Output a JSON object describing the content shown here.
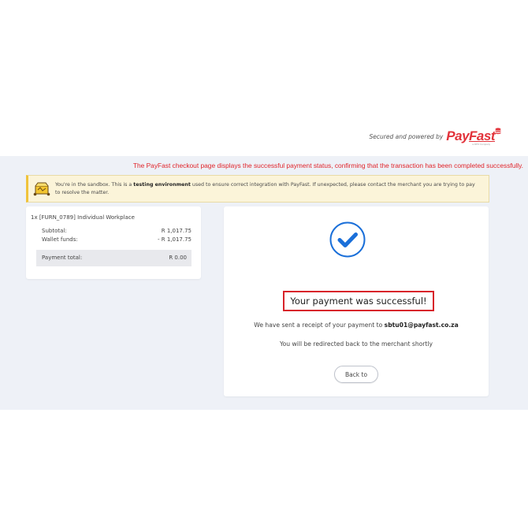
{
  "header": {
    "powered_text": "Secured and powered by",
    "logo_word_pay": "Pay",
    "logo_word_fast": "Fast",
    "logo_sub": "a DPO Company"
  },
  "annotation": {
    "text": "The PayFast checkout page displays the successful payment status, confirming that the transaction has been completed successfully."
  },
  "sandbox": {
    "icon": "sandbox-icon",
    "text_before": "You're in the sandbox. This is a ",
    "text_bold": "testing environment",
    "text_after": " used to ensure correct integration with PayFast. If unexpected, please contact the merchant you are trying to pay",
    "text_line2": "to resolve the matter."
  },
  "summary": {
    "item_title": "1x [FURN_0789] Individual Workplace",
    "subtotal_label": "Subtotal:",
    "subtotal_value": "R 1,017.75",
    "wallet_label": "Wallet funds:",
    "wallet_value": "- R 1,017.75",
    "total_label": "Payment total:",
    "total_value": "R 0.00"
  },
  "success": {
    "icon": "checkmark-circle-icon",
    "title": "Your payment was successful!",
    "receipt_prefix": "We have sent a receipt of your payment to ",
    "receipt_email": "sbtu01@payfast.co.za",
    "redirect_text": "You will be redirected back to the merchant shortly",
    "back_button": "Back to"
  },
  "colors": {
    "brand_red": "#e2323a",
    "check_blue": "#1a6fd9",
    "band_bg": "#eef1f7",
    "banner_bg": "#fbf4d9"
  }
}
